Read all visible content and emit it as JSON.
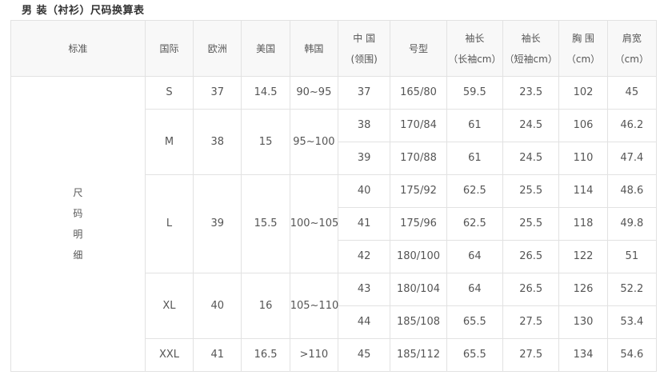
{
  "title": "男 装（衬衫）尺码换算表",
  "headers": {
    "standard": "标准",
    "international": "国际",
    "europe": "欧洲",
    "usa": "美国",
    "korea": "韩国",
    "china_line1": "中 国",
    "china_line2": "(领围)",
    "model": "号型",
    "long_line1": "袖长",
    "long_line2": "（长袖cm）",
    "short_line1": "袖长",
    "short_line2": "（短袖cm）",
    "chest_line1": "胸 围",
    "chest_line2": "（cm）",
    "shoulder_line1": "肩宽",
    "shoulder_line2": "（cm）"
  },
  "standard_label": [
    "尺",
    "码",
    "明",
    "细"
  ],
  "groups": [
    {
      "size": "S",
      "eu": "37",
      "us": "14.5",
      "kr": "90~95",
      "rows": [
        {
          "cn": "37",
          "model": "165/80",
          "long": "59.5",
          "short": "23.5",
          "chest": "102",
          "shoulder": "45"
        }
      ]
    },
    {
      "size": "M",
      "eu": "38",
      "us": "15",
      "kr": "95~100",
      "rows": [
        {
          "cn": "38",
          "model": "170/84",
          "long": "61",
          "short": "24.5",
          "chest": "106",
          "shoulder": "46.2"
        },
        {
          "cn": "39",
          "model": "170/88",
          "long": "61",
          "short": "24.5",
          "chest": "110",
          "shoulder": "47.4"
        }
      ]
    },
    {
      "size": "L",
      "eu": "39",
      "us": "15.5",
      "kr": "100~105",
      "rows": [
        {
          "cn": "40",
          "model": "175/92",
          "long": "62.5",
          "short": "25.5",
          "chest": "114",
          "shoulder": "48.6"
        },
        {
          "cn": "41",
          "model": "175/96",
          "long": "62.5",
          "short": "25.5",
          "chest": "118",
          "shoulder": "49.8"
        },
        {
          "cn": "42",
          "model": "180/100",
          "long": "64",
          "short": "26.5",
          "chest": "122",
          "shoulder": "51"
        }
      ]
    },
    {
      "size": "XL",
      "eu": "40",
      "us": "16",
      "kr": "105~110",
      "rows": [
        {
          "cn": "43",
          "model": "180/104",
          "long": "64",
          "short": "26.5",
          "chest": "126",
          "shoulder": "52.2"
        },
        {
          "cn": "44",
          "model": "185/108",
          "long": "65.5",
          "short": "27.5",
          "chest": "130",
          "shoulder": "53.4"
        }
      ]
    },
    {
      "size": "XXL",
      "eu": "41",
      "us": "16.5",
      "kr": ">110",
      "rows": [
        {
          "cn": "45",
          "model": "185/112",
          "long": "65.5",
          "short": "27.5",
          "chest": "134",
          "shoulder": "54.6"
        }
      ]
    }
  ]
}
